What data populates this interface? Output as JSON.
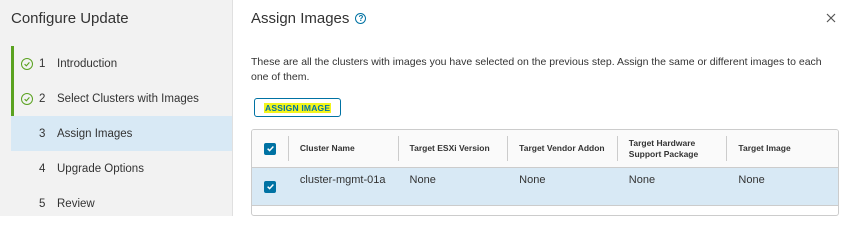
{
  "wizard": {
    "title": "Configure Update",
    "steps": [
      {
        "number": "1",
        "label": "Introduction",
        "state": "completed"
      },
      {
        "number": "2",
        "label": "Select Clusters with Images",
        "state": "completed"
      },
      {
        "number": "3",
        "label": "Assign Images",
        "state": "active"
      },
      {
        "number": "4",
        "label": "Upgrade Options",
        "state": "pending"
      },
      {
        "number": "5",
        "label": "Review",
        "state": "pending"
      }
    ]
  },
  "main": {
    "title": "Assign Images",
    "description": "These are all the clusters with images you have selected on the previous step. Assign the same or different images to each one of them.",
    "assign_button": "ASSIGN IMAGE",
    "table": {
      "columns": [
        "Cluster Name",
        "Target ESXi Version",
        "Target Vendor Addon",
        "Target Hardware Support Package",
        "Target Image"
      ],
      "rows": [
        {
          "selected": true,
          "cells": [
            "cluster-mgmt-01a",
            "None",
            "None",
            "None",
            "None"
          ]
        }
      ]
    }
  },
  "icons": {
    "help": "help-circle-icon",
    "close": "close-icon",
    "check": "check-circle-icon"
  },
  "colors": {
    "accent": "#0072a3",
    "success": "#5aa220",
    "highlight": "#f3f51c",
    "selected_row": "#d8e9f5"
  }
}
